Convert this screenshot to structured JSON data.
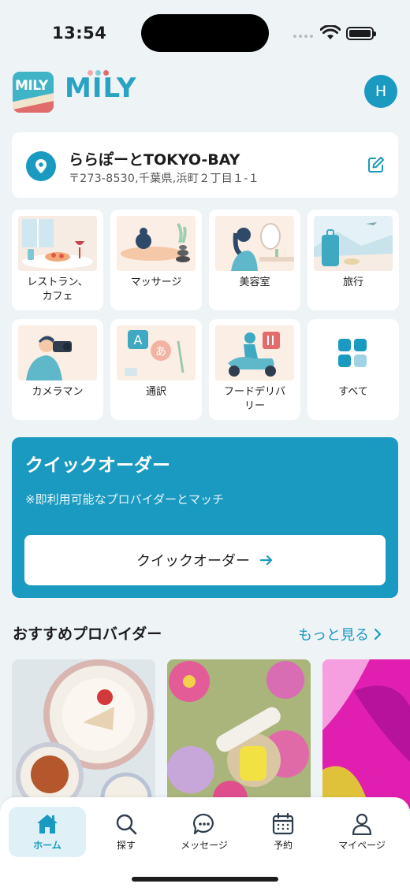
{
  "status_bar": {
    "time": "13:54"
  },
  "header": {
    "brand": "MILY",
    "logo_text": "MILY",
    "avatar_initial": "H"
  },
  "location": {
    "name": "ららぽーとTOKYO-BAY",
    "address": "〒273-8530,千葉県,浜町２丁目１-１"
  },
  "categories": [
    {
      "label": "レストラン、\nカフェ",
      "icon": "restaurant-illustration"
    },
    {
      "label": "マッサージ",
      "icon": "massage-illustration"
    },
    {
      "label": "美容室",
      "icon": "salon-illustration"
    },
    {
      "label": "旅行",
      "icon": "travel-illustration"
    },
    {
      "label": "カメラマン",
      "icon": "camera-illustration"
    },
    {
      "label": "通訳",
      "icon": "translation-illustration"
    },
    {
      "label": "フードデリバ\nリー",
      "icon": "delivery-illustration"
    },
    {
      "label": "すべて",
      "icon": "grid-icon"
    }
  ],
  "quick_order": {
    "title": "クイックオーダー",
    "subtitle": "※即利用可能なプロバイダーとマッチ",
    "button_label": "クイックオーダー"
  },
  "recommended": {
    "title": "おすすめプロバイダー",
    "see_more": "もっと見る"
  },
  "tabs": [
    {
      "label": "ホーム",
      "icon": "home-icon",
      "active": true
    },
    {
      "label": "探す",
      "icon": "search-icon",
      "active": false
    },
    {
      "label": "メッセージ",
      "icon": "message-icon",
      "active": false
    },
    {
      "label": "予約",
      "icon": "calendar-icon",
      "active": false
    },
    {
      "label": "マイページ",
      "icon": "person-icon",
      "active": false
    }
  ],
  "colors": {
    "accent": "#1a9ac0",
    "background": "#eef3f6"
  }
}
